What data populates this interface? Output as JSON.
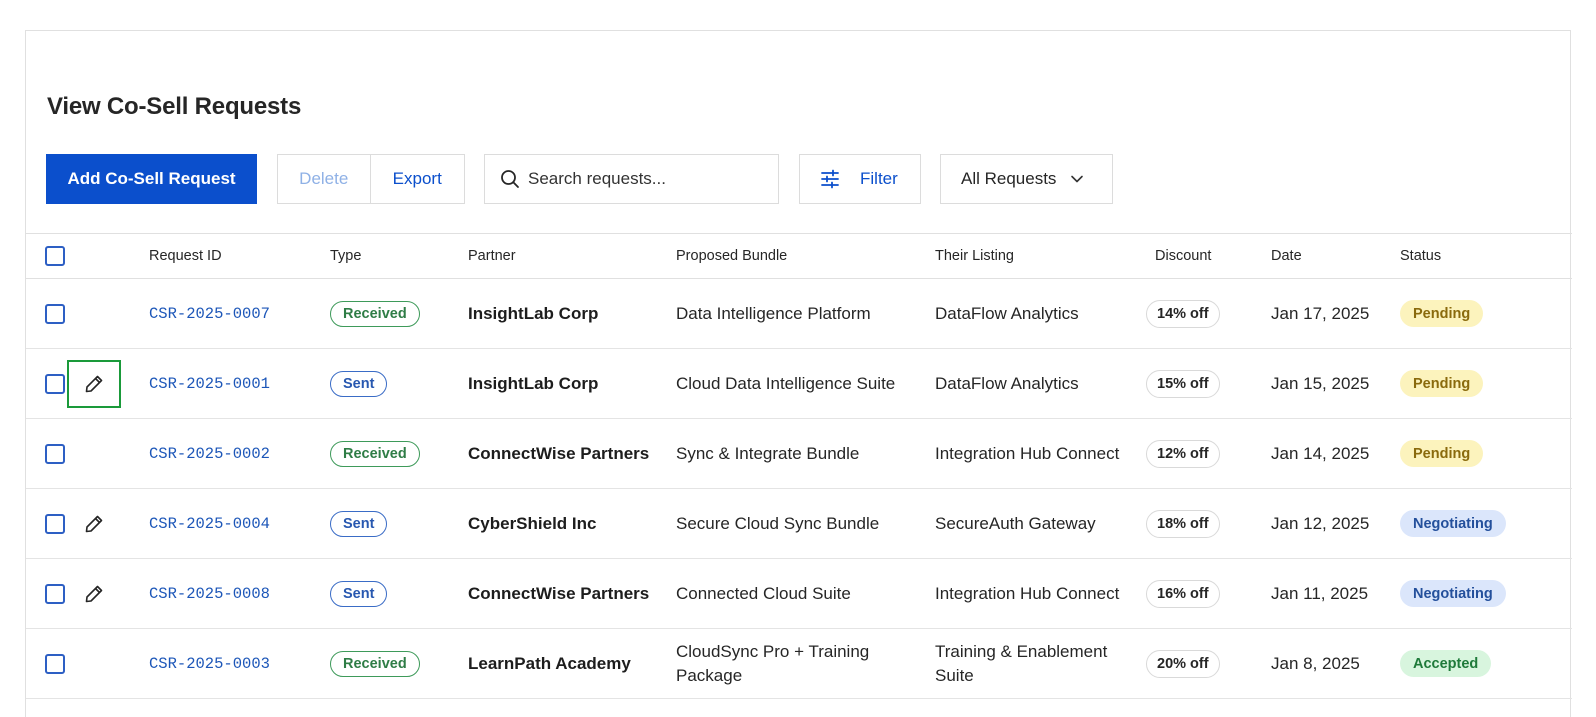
{
  "page": {
    "title": "View Co-Sell Requests"
  },
  "toolbar": {
    "add_label": "Add Co-Sell Request",
    "delete_label": "Delete",
    "export_label": "Export",
    "search_placeholder": "Search requests...",
    "filter_label": "Filter",
    "view_select": "All Requests"
  },
  "table": {
    "columns": [
      "Request ID",
      "Type",
      "Partner",
      "Proposed Bundle",
      "Their Listing",
      "Discount",
      "Date",
      "Status"
    ],
    "rows": [
      {
        "id": "CSR-2025-0007",
        "type": "Received",
        "partner": "InsightLab Corp",
        "bundle": "Data Intelligence Platform",
        "listing": "DataFlow Analytics",
        "discount": "14% off",
        "date": "Jan 17, 2025",
        "status": "Pending",
        "editable": false,
        "edit_focused": false
      },
      {
        "id": "CSR-2025-0001",
        "type": "Sent",
        "partner": "InsightLab Corp",
        "bundle": "Cloud Data Intelligence Suite",
        "listing": "DataFlow Analytics",
        "discount": "15% off",
        "date": "Jan 15, 2025",
        "status": "Pending",
        "editable": true,
        "edit_focused": true
      },
      {
        "id": "CSR-2025-0002",
        "type": "Received",
        "partner": "ConnectWise Partners",
        "bundle": "Sync & Integrate Bundle",
        "listing": "Integration Hub Connect",
        "discount": "12% off",
        "date": "Jan 14, 2025",
        "status": "Pending",
        "editable": false,
        "edit_focused": false
      },
      {
        "id": "CSR-2025-0004",
        "type": "Sent",
        "partner": "CyberShield Inc",
        "bundle": "Secure Cloud Sync Bundle",
        "listing": "SecureAuth Gateway",
        "discount": "18% off",
        "date": "Jan 12, 2025",
        "status": "Negotiating",
        "editable": true,
        "edit_focused": false
      },
      {
        "id": "CSR-2025-0008",
        "type": "Sent",
        "partner": "ConnectWise Partners",
        "bundle": "Connected Cloud Suite",
        "listing": "Integration Hub Connect",
        "discount": "16% off",
        "date": "Jan 11, 2025",
        "status": "Negotiating",
        "editable": true,
        "edit_focused": false
      },
      {
        "id": "CSR-2025-0003",
        "type": "Received",
        "partner": "LearnPath Academy",
        "bundle": "CloudSync Pro + Training Package",
        "listing": "Training & Enablement Suite",
        "discount": "20% off",
        "date": "Jan 8, 2025",
        "status": "Accepted",
        "editable": false,
        "edit_focused": false
      }
    ]
  },
  "icons": {
    "search": "search-icon",
    "filter": "sliders-icon",
    "dropdown": "chevron-down-icon",
    "edit": "pencil-icon"
  },
  "colors": {
    "primary": "#0b4fcc",
    "focus": "#1a9a3a",
    "pending_bg": "#fcf3bd",
    "negotiating_bg": "#dbe6fb",
    "accepted_bg": "#d8f5de"
  }
}
